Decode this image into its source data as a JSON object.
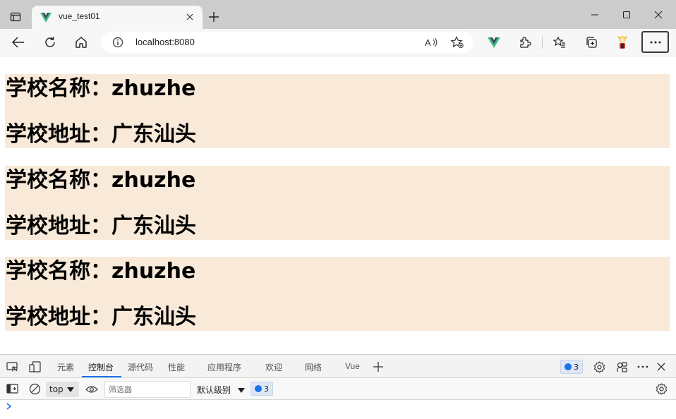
{
  "browser": {
    "tab": {
      "title": "vue_test01"
    },
    "url": "localhost:8080"
  },
  "page": {
    "schools": [
      {
        "name_line": "学校名称：zhuzhe",
        "address_line": "学校地址：广东汕头"
      },
      {
        "name_line": "学校名称：zhuzhe",
        "address_line": "学校地址：广东汕头"
      },
      {
        "name_line": "学校名称：zhuzhe",
        "address_line": "学校地址：广东汕头"
      }
    ],
    "block_color": "#f8e9d8"
  },
  "devtools": {
    "tabs": [
      "元素",
      "控制台",
      "源代码",
      "性能",
      "应用程序",
      "欢迎",
      "网络",
      "Vue"
    ],
    "active_tab": "控制台",
    "issues_count": "3",
    "context": "top",
    "filter_placeholder": "筛选器",
    "level": "默认级别",
    "console_issues_count": "3",
    "accent": "#1a73e8"
  }
}
